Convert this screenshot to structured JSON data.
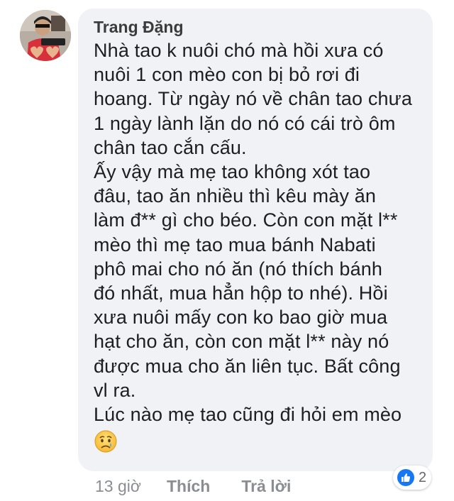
{
  "comment": {
    "author": "Trang Đặng",
    "paragraphs": [
      "Nhà tao k nuôi chó mà hồi xưa có",
      "nuôi 1 con mèo con bị bỏ rơi đi",
      "hoang. Từ ngày nó về chân tao chưa",
      "1 ngày lành lặn do nó có cái trò ôm",
      "chân tao cắn cấu.",
      "Ấy vậy mà mẹ tao không xót tao",
      "đâu, tao ăn nhiều thì kêu mày ăn",
      "làm đ** gì cho béo. Còn con mặt l**",
      "mèo thì mẹ tao mua bánh Nabati",
      "phô mai cho nó ăn (nó thích bánh",
      "đó nhất, mua hẳn hộp to nhé). Hồi",
      "xưa nuôi mấy con ko bao giờ mua",
      "hạt cho ăn, còn con mặt l** này nó",
      "được mua cho ăn liên tục. Bất công",
      "vl ra.",
      "Lúc nào mẹ tao cũng đi hỏi em mèo"
    ],
    "emoji_icon": "sad-tear-face-icon"
  },
  "footer": {
    "time": "13 giờ",
    "like_label": "Thích",
    "reply_label": "Trả lời"
  },
  "reactions": {
    "icon": "like-icon",
    "count": "2",
    "color": "#1877f2"
  }
}
